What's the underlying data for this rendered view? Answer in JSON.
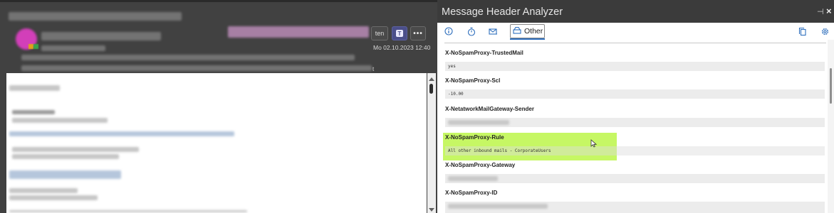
{
  "reading_pane": {
    "partial_button_label": "ten",
    "datetime": "Mo 02.10.2023 12:40",
    "trailing_char": "t",
    "teams_glyph": "T",
    "more_glyph": "•••"
  },
  "addin": {
    "title": "Message Header Analyzer",
    "pin_glyph": "⊣",
    "close_glyph": "×",
    "tabs": {
      "active_label": "Other"
    },
    "headers": [
      {
        "name": "X-NoSpamProxy-TrustedMail",
        "value": "yes"
      },
      {
        "name": "X-NoSpamProxy-Scl",
        "value": "-10.00"
      },
      {
        "name": "X-NetatworkMailGateway-Sender",
        "value": ""
      },
      {
        "name": "X-NoSpamProxy-Rule",
        "value": "All other inbound mails - CorporateUsers",
        "highlighted": true
      },
      {
        "name": "X-NoSpamProxy-Gateway",
        "value": ""
      },
      {
        "name": "X-NoSpamProxy-ID",
        "value": ""
      }
    ]
  },
  "colors": {
    "highlight": "#b9f542",
    "accent": "#2f6fbd",
    "dark_chrome": "#3b3b3b"
  },
  "icons": [
    "info-icon",
    "timer-icon",
    "mail-icon",
    "other-tab-icon",
    "copy-icon",
    "settings-icon",
    "pin-icon",
    "close-icon"
  ]
}
